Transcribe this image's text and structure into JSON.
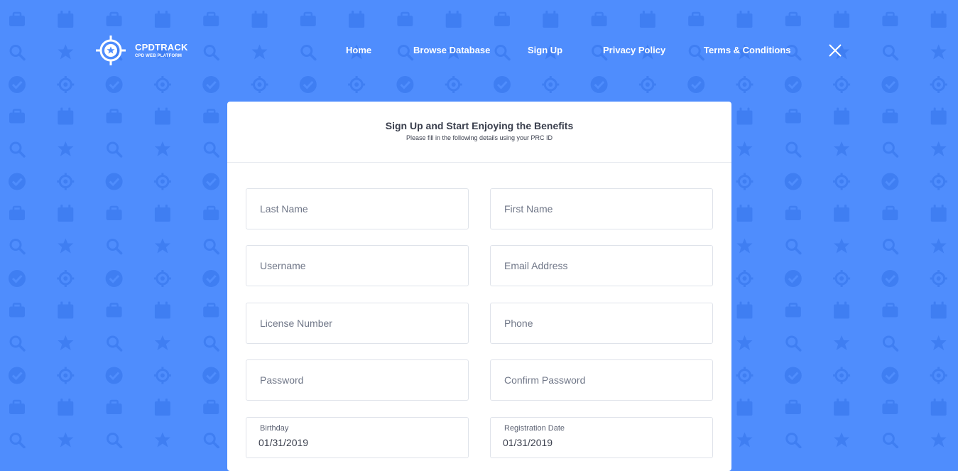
{
  "brand": {
    "name": "CPDTRACK",
    "tagline": "CPD WEB PLATFORM"
  },
  "nav": {
    "items": [
      {
        "id": "home",
        "label": "Home"
      },
      {
        "id": "browse",
        "label": "Browse Database"
      },
      {
        "id": "signup",
        "label": "Sign Up"
      },
      {
        "id": "privacy",
        "label": "Privacy Policy"
      },
      {
        "id": "terms",
        "label": "Terms & Conditions"
      }
    ],
    "close_icon": "close-x-icon"
  },
  "form": {
    "title": "Sign Up and Start Enjoying the Benefits",
    "subtitle": "Please fill in the following details using your PRC ID",
    "fields": {
      "last_name": {
        "placeholder": "Last Name",
        "value": ""
      },
      "first_name": {
        "placeholder": "First Name",
        "value": ""
      },
      "username": {
        "placeholder": "Username",
        "value": ""
      },
      "email": {
        "placeholder": "Email Address",
        "value": ""
      },
      "license": {
        "placeholder": "License Number",
        "value": ""
      },
      "phone": {
        "placeholder": "Phone",
        "value": ""
      },
      "password": {
        "placeholder": "Password",
        "value": ""
      },
      "confirm_password": {
        "placeholder": "Confirm Password",
        "value": ""
      },
      "birthday": {
        "label": "Birthday",
        "value": "01/31/2019"
      },
      "registration_date": {
        "label": "Registration Date",
        "value": "01/31/2019"
      }
    }
  },
  "colors": {
    "background": "#4f8dfd",
    "pattern_icon": "#3f7ef2",
    "card": "#ffffff",
    "text_dark": "#3a3f4d"
  },
  "background_icons": [
    "briefcase-icon",
    "calendar-icon",
    "search-icon",
    "star-icon",
    "check-circle-icon",
    "target-icon"
  ]
}
